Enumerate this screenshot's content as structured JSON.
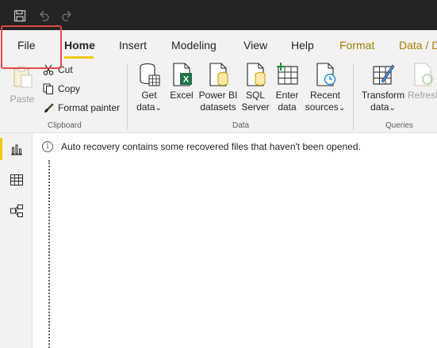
{
  "quick_access": {
    "icons": [
      "save-icon",
      "undo-icon",
      "redo-icon"
    ]
  },
  "menu": {
    "tabs": [
      {
        "label": "File"
      },
      {
        "label": "Home"
      },
      {
        "label": "Insert"
      },
      {
        "label": "Modeling"
      },
      {
        "label": "View"
      },
      {
        "label": "Help"
      },
      {
        "label": "Format"
      },
      {
        "label": "Data / D"
      }
    ],
    "active_tab": "Home",
    "highlighted_tab": "File"
  },
  "ribbon": {
    "clipboard": {
      "paste": "Paste",
      "cut": "Cut",
      "copy": "Copy",
      "format_painter": "Format painter",
      "group_label": "Clipboard"
    },
    "data": {
      "get_data_1": "Get",
      "get_data_2": "data",
      "excel": "Excel",
      "power_bi_1": "Power BI",
      "power_bi_2": "datasets",
      "sql_1": "SQL",
      "sql_2": "Server",
      "enter_1": "Enter",
      "enter_2": "data",
      "recent_1": "Recent",
      "recent_2": "sources",
      "group_label": "Data"
    },
    "queries": {
      "transform_1": "Transform",
      "transform_2": "data",
      "refresh": "Refresh",
      "group_label": "Queries"
    },
    "dropdown_glyph": "⌄"
  },
  "infobar": {
    "icon_glyph": "i",
    "message": "Auto recovery contains some recovered files that haven't been opened."
  },
  "leftnav": {
    "items": [
      "report-view-icon",
      "data-view-icon",
      "model-view-icon"
    ],
    "active": "report-view-icon"
  },
  "colors": {
    "accent_yellow": "#f2c811",
    "highlight_red": "#e34a4a",
    "titlebar": "#252423",
    "ribbon_bg": "#f3f2f1",
    "excel_green": "#217346",
    "contextual_tab": "#a67c00"
  }
}
